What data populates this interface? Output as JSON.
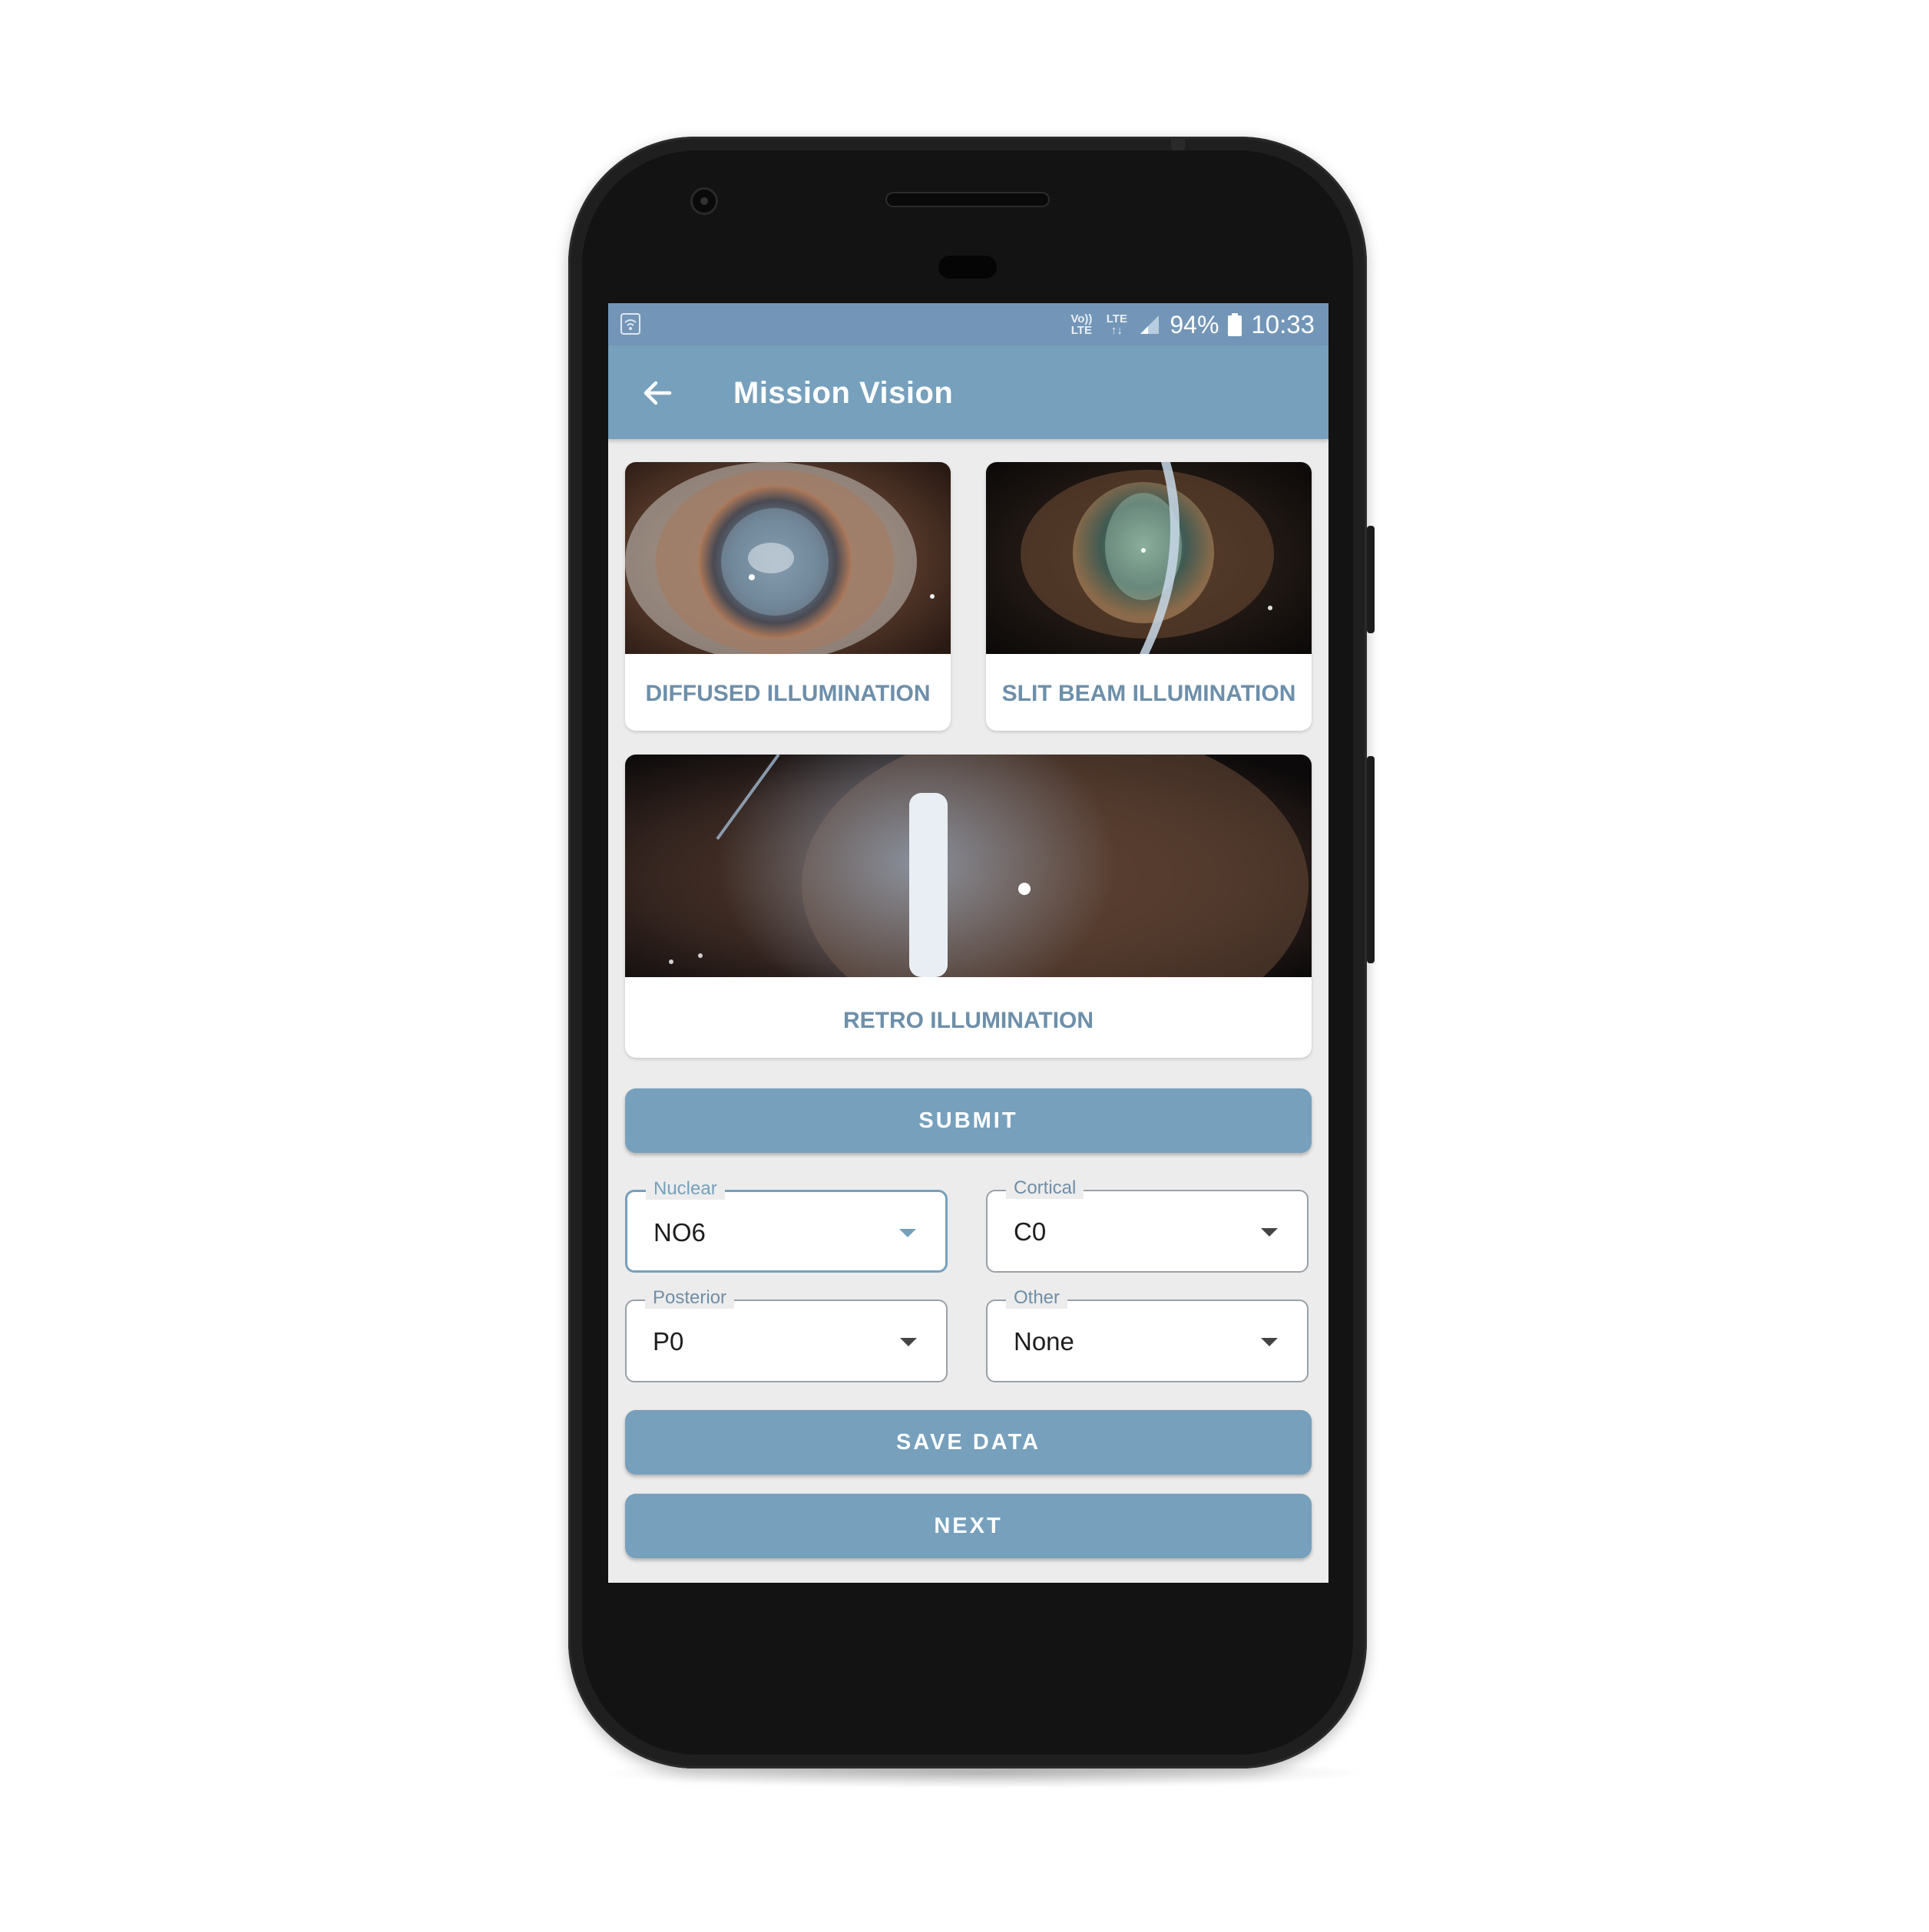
{
  "status_bar": {
    "volte": "Vo)) LTE",
    "lte": "LTE",
    "battery_percent": "94%",
    "time": "10:33"
  },
  "app_bar": {
    "title": "Mission Vision",
    "back_icon": "arrow-left-icon"
  },
  "cards": [
    {
      "label": "DIFFUSED ILLUMINATION"
    },
    {
      "label": "SLIT BEAM ILLUMINATION"
    },
    {
      "label": "RETRO ILLUMINATION"
    }
  ],
  "buttons": {
    "submit": "SUBMIT",
    "save": "SAVE DATA",
    "next": "NEXT"
  },
  "selects": {
    "nuclear": {
      "label": "Nuclear",
      "value": "NO6"
    },
    "cortical": {
      "label": "Cortical",
      "value": "C0"
    },
    "posterior": {
      "label": "Posterior",
      "value": "P0"
    },
    "other": {
      "label": "Other",
      "value": "None"
    }
  },
  "colors": {
    "status_bar": "#7396b8",
    "app_bar": "#76a0bc",
    "accent": "#76a0bc",
    "card_label": "#6d8faa",
    "screen_bg": "#ececec"
  }
}
